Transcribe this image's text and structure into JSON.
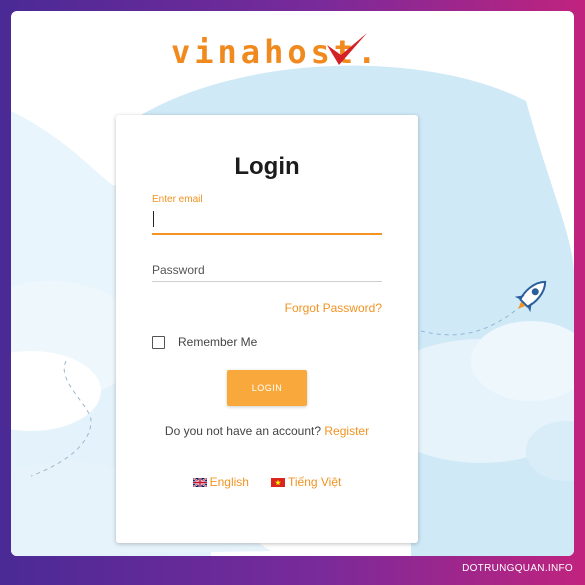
{
  "brand": {
    "logo_text": "vinahost.",
    "colors": {
      "brand_orange": "#f08a1e",
      "check_red": "#d42027"
    }
  },
  "login_form": {
    "title": "Login",
    "email_label": "Enter email",
    "email_value": "",
    "password_placeholder": "Password",
    "forgot_password": "Forgot Password?",
    "remember_me": "Remember Me",
    "remember_checked": false,
    "login_button": "LOGIN",
    "register_prompt": "Do you not have an account?",
    "register_link": "Register"
  },
  "languages": [
    {
      "label": "English",
      "icon": "uk-flag-icon"
    },
    {
      "label": "Tiếng Việt",
      "icon": "vietnam-flag-icon"
    }
  ],
  "decorations": {
    "rocket_icon": "rocket-icon",
    "accent_color": "#f29322"
  },
  "watermark": "DOTRUNGQUAN.INFO"
}
